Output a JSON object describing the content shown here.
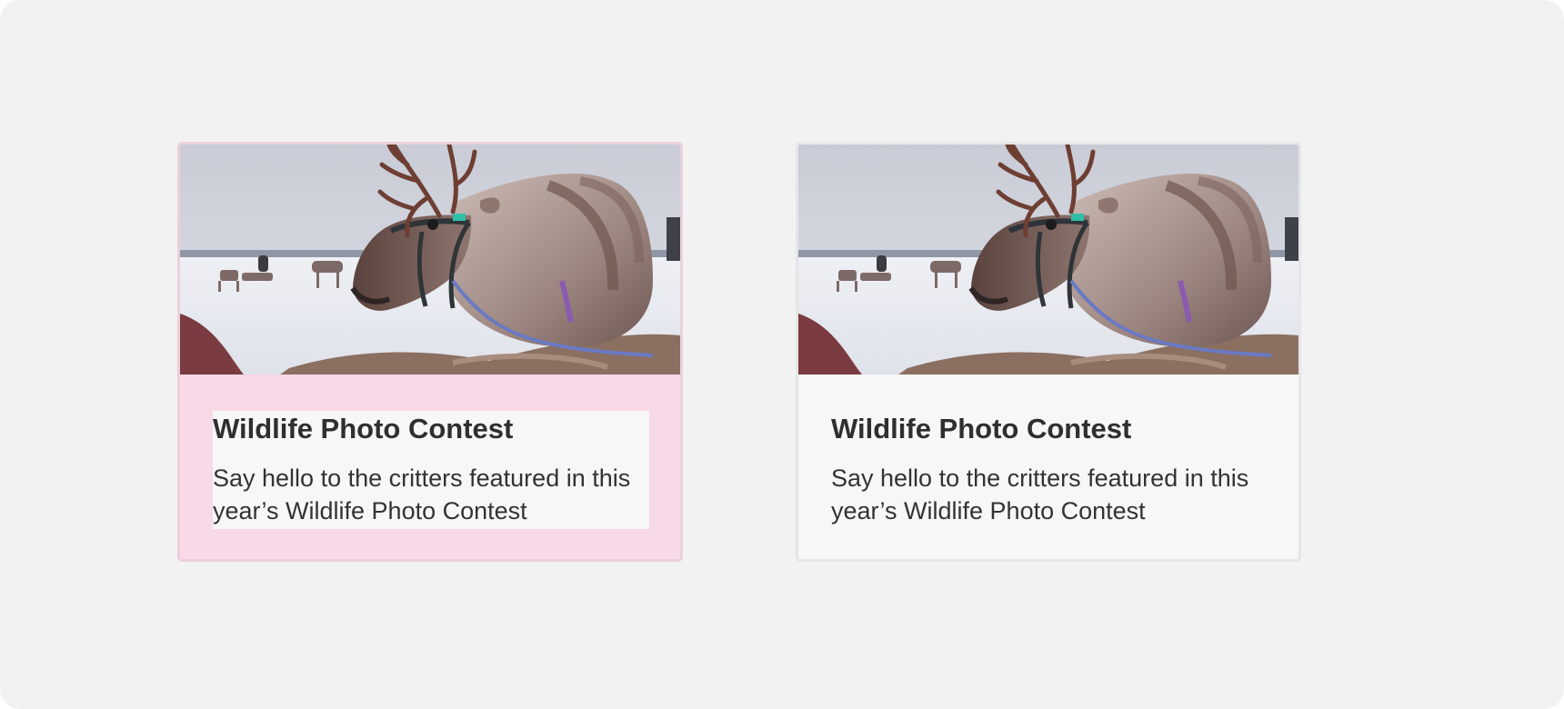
{
  "cards": [
    {
      "variant": "highlighted",
      "image_description": "reindeer-in-snow",
      "title": "Wildlife Photo Contest",
      "description": "Say hello to the critters featured in this year’s Wildlife Photo Contest"
    },
    {
      "variant": "default",
      "image_description": "reindeer-in-snow",
      "title": "Wildlife Photo Contest",
      "description": "Say hello to the critters featured in this year’s Wildlife Photo Contest"
    }
  ],
  "colors": {
    "background": "#f2f2f2",
    "card": "#f7f7f7",
    "highlight_padding": "#f8d9e7",
    "text": "#2f2f2f"
  }
}
